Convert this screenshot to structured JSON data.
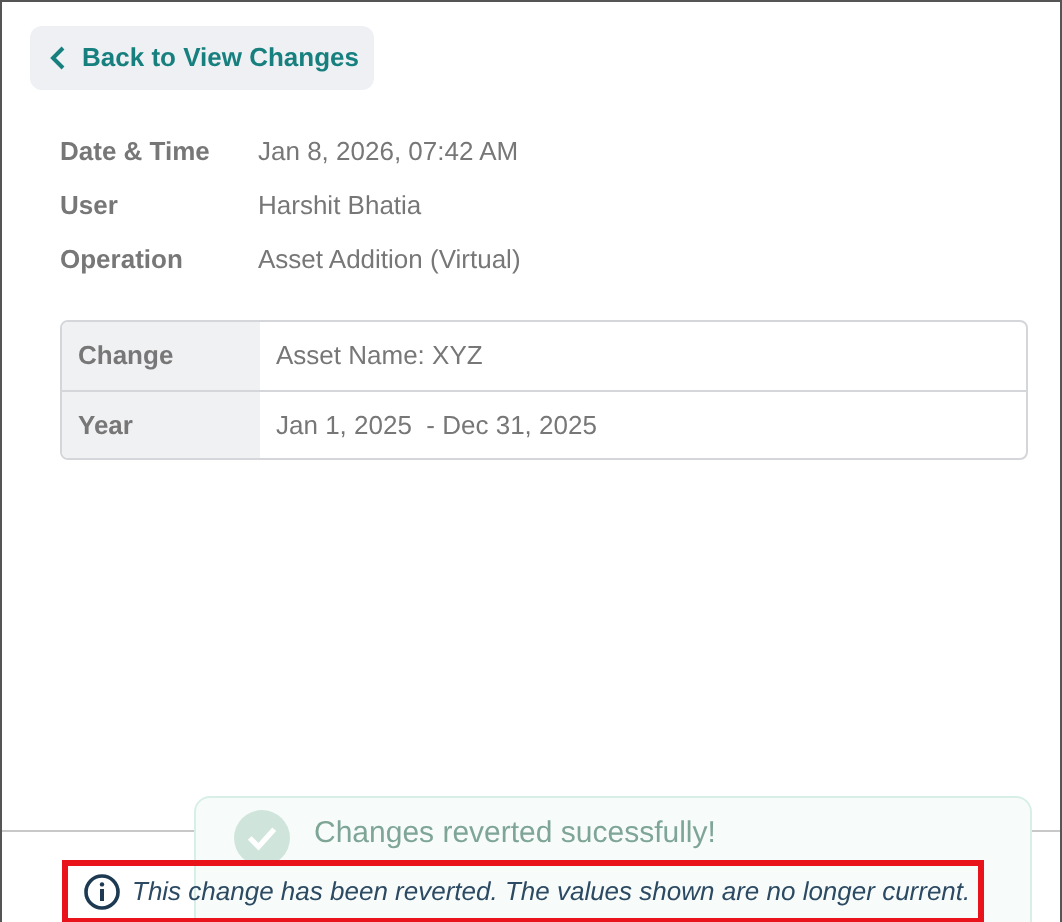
{
  "back_button": {
    "label": "Back to View Changes"
  },
  "details": [
    {
      "label": "Date & Time",
      "value": "Jan 8, 2026, 07:42 AM"
    },
    {
      "label": "User",
      "value": "Harshit Bhatia"
    },
    {
      "label": "Operation",
      "value": "Asset Addition (Virtual)"
    }
  ],
  "table": {
    "rows": [
      {
        "label": "Change",
        "value": "Asset Name: XYZ"
      },
      {
        "label": "Year",
        "value": "Jan 1, 2025  - Dec 31, 2025"
      }
    ]
  },
  "toast": {
    "message": "Changes reverted sucessfully!"
  },
  "footer_notice": {
    "text": "This change has been reverted. The values shown are no longer current.",
    "highlighted": true
  }
}
